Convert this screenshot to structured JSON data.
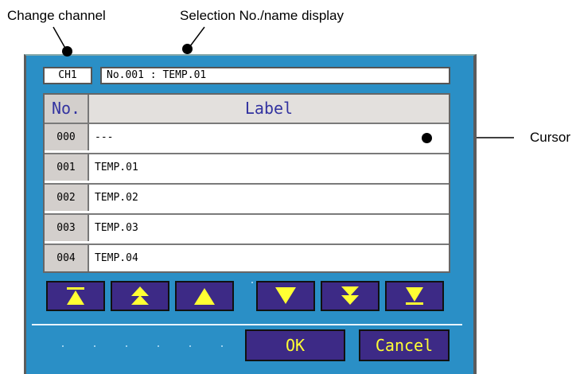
{
  "callouts": {
    "change_channel": "Change channel",
    "selection_display": "Selection No./name display",
    "cursor": "Cursor"
  },
  "channel": {
    "label": "CH1"
  },
  "selection": {
    "text": "No.001 : TEMP.01"
  },
  "table": {
    "headers": {
      "no": "No.",
      "label": "Label"
    },
    "rows": [
      {
        "no": "000",
        "label": "---"
      },
      {
        "no": "001",
        "label": "TEMP.01"
      },
      {
        "no": "002",
        "label": "TEMP.02"
      },
      {
        "no": "003",
        "label": "TEMP.03"
      },
      {
        "no": "004",
        "label": "TEMP.04"
      }
    ]
  },
  "nav_buttons": [
    {
      "icon": "first-page-icon"
    },
    {
      "icon": "page-up-icon"
    },
    {
      "icon": "scroll-up-icon"
    },
    {
      "icon": "scroll-down-icon"
    },
    {
      "icon": "page-down-icon"
    },
    {
      "icon": "last-page-icon"
    }
  ],
  "actions": {
    "ok": "OK",
    "cancel": "Cancel"
  },
  "colors": {
    "panel_bg": "#2a8fc6",
    "button_bg": "#3d2a86",
    "button_glyph": "#ffff33",
    "header_text": "#3333a0"
  }
}
